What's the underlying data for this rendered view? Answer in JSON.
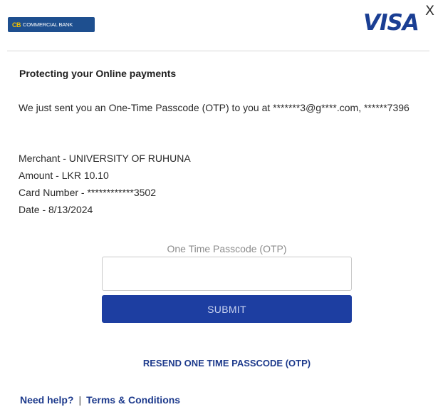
{
  "header": {
    "bank_logo_mark": "CB",
    "bank_logo_text": "COMMERCIAL BANK",
    "visa_logo": "VISA",
    "close_label": "X"
  },
  "content": {
    "heading": "Protecting your Online payments",
    "message": "We just sent you an One-Time Passcode (OTP) to you at *******3@g****.com, ******7396",
    "details": {
      "merchant": "Merchant - UNIVERSITY OF RUHUNA",
      "amount": "Amount - LKR 10.10",
      "card_number": "Card Number - ************3502",
      "date": "Date - 8/13/2024"
    }
  },
  "form": {
    "otp_label": "One Time Passcode (OTP)",
    "otp_value": "",
    "submit_label": "SUBMIT",
    "resend_label": "RESEND ONE TIME PASSCODE (OTP)"
  },
  "footer": {
    "help_label": "Need help?",
    "separator": "|",
    "terms_label": "Terms & Conditions"
  },
  "colors": {
    "brand_blue": "#1d3ea1",
    "visa_blue": "#1a3e93",
    "bank_blue": "#1e4f8f"
  },
  "icons": {
    "close": "close-icon"
  }
}
